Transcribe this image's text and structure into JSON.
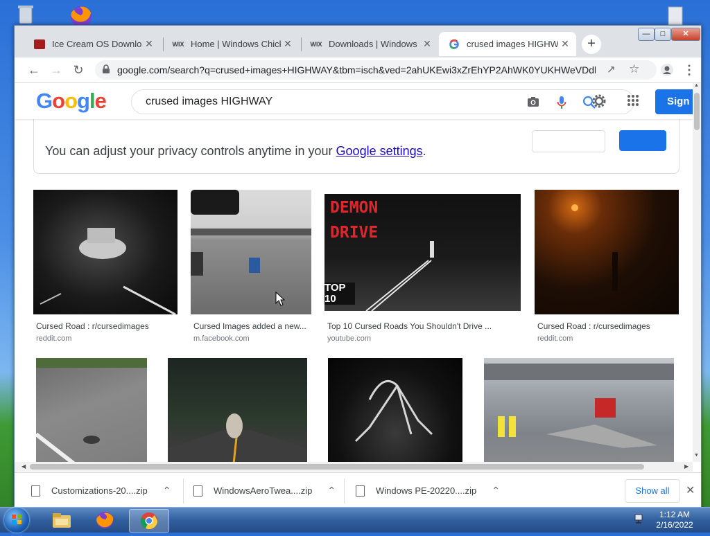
{
  "browser": {
    "tabs": [
      {
        "title": "Ice Cream OS Download",
        "icon": "ice-cream-os-favicon"
      },
      {
        "title": "Home | Windows Chicken",
        "icon": "wix-favicon",
        "favicon_text": "WIX"
      },
      {
        "title": "Downloads | Windows Ch",
        "icon": "wix-favicon",
        "favicon_text": "WIX"
      },
      {
        "title": "crused images HIGHWAY",
        "icon": "google-favicon",
        "active": true
      }
    ],
    "new_tab_label": "+",
    "address_url": "google.com/search?q=crused+images+HIGHWAY&tbm=isch&ved=2ahUKEwi3xZrEhYP2AhWK0YUKHWeVDdk..."
  },
  "google": {
    "logo": "Google",
    "query": "crused images HIGHWAY",
    "sign_in": "Sign i",
    "privacy_text": "You can adjust your privacy controls anytime in your ",
    "privacy_link": "Google settings",
    "privacy_end": ".",
    "results_row1": [
      {
        "caption": "Cursed Road : r/cursedimages",
        "source": "reddit.com"
      },
      {
        "caption": "Cursed Images added a new...",
        "source": "m.facebook.com"
      },
      {
        "caption": "Top 10 Cursed Roads You Shouldn't Drive ...",
        "source": "youtube.com",
        "overlay_title": "DEMON DRIVE",
        "overlay_badge": "TOP 10"
      },
      {
        "caption": "Cursed Road : r/cursedimages",
        "source": "reddit.com"
      }
    ]
  },
  "downloads": [
    {
      "name": "Customizations-20....zip"
    },
    {
      "name": "WindowsAeroTwea....zip"
    },
    {
      "name": "Windows PE-20220....zip"
    }
  ],
  "downloads_show_all": "Show all",
  "taskbar": {
    "time": "1:12 AM",
    "date": "2/16/2022"
  },
  "colors": {
    "google_blue": "#4285F4",
    "google_red": "#EA4335",
    "google_yellow": "#FBBC05",
    "google_green": "#34A853",
    "sign_in_button": "#1a73e8",
    "link": "#1a0dab"
  }
}
